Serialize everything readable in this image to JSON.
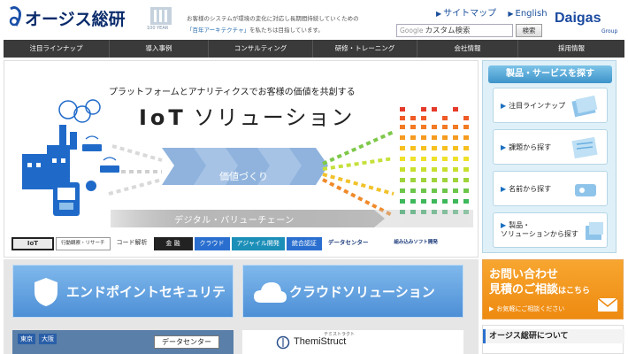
{
  "header": {
    "company_name": "オージス総研",
    "year_badge": "100 YEAR",
    "tagline_prefix": "お客様のシステムが環境の変化に対応し長期間持続していくための",
    "tagline_highlight": "「百年アーキテクチャ」",
    "tagline_suffix": "を私たちは目指しています。",
    "sitemap_label": "サイトマップ",
    "english_label": "English",
    "search_google": "Google",
    "search_placeholder": "カスタム検索",
    "search_button": "検索",
    "group_logo": "Daigas",
    "group_sub": "Group"
  },
  "nav": {
    "items": [
      {
        "label": "注目ラインナップ"
      },
      {
        "label": "導入事例"
      },
      {
        "label": "コンサルティング"
      },
      {
        "label": "研修・トレーニング"
      },
      {
        "label": "会社情報"
      },
      {
        "label": "採用情報"
      }
    ]
  },
  "hero": {
    "subtitle": "プラットフォームとアナリティクスでお客様の価値を共創する",
    "title_iot": "IoT",
    "title_rest": "ソリューション",
    "value_text": "価値づくり",
    "chain_label": "デジタル・バリューチェーン",
    "tabs": [
      {
        "label": "IoT",
        "style": "iot"
      },
      {
        "label": "行動観察・リサーチ",
        "style": "normal"
      },
      {
        "label": "コード解析",
        "style": "normal"
      },
      {
        "label": "金 融",
        "style": "dark"
      },
      {
        "label": "クラウド",
        "style": "blue"
      },
      {
        "label": "アジャイル開発",
        "style": "teal"
      },
      {
        "label": "統合認証",
        "style": "blue"
      },
      {
        "label": "データセンター",
        "style": "plain"
      },
      {
        "label": "組み込みソフト開発",
        "style": "plain"
      }
    ]
  },
  "side": {
    "heading": "製品・サービスを探す",
    "cards": [
      {
        "label": "注目ラインナップ",
        "icon": "lineup-icon"
      },
      {
        "label": "課題から探す",
        "icon": "problem-icon"
      },
      {
        "label": "名前から探す",
        "icon": "name-icon"
      },
      {
        "label": "製品・",
        "label2": "ソリューションから探す",
        "icon": "solution-icon"
      }
    ]
  },
  "lower": {
    "security_label": "エンドポイントセキュリティ",
    "cloud_label": "クラウドソリューション",
    "tokyo": "東京",
    "osaka": "大阪",
    "datacenter": "データセンター",
    "themistruct": "ThemiStruct",
    "themistruct_kana": "テミストラクト"
  },
  "contact": {
    "line1": "お問い合わせ",
    "line2_main": "見積のご相談",
    "line2_small": "はこちら",
    "line3": "お気軽にご相談ください"
  },
  "about": {
    "heading": "オージス総研について"
  },
  "colors": {
    "nav_bg": "#3a3a3a",
    "brand_blue": "#1b4aa0",
    "accent_orange": "#f39a20",
    "side_bg": "#dff0f8"
  }
}
